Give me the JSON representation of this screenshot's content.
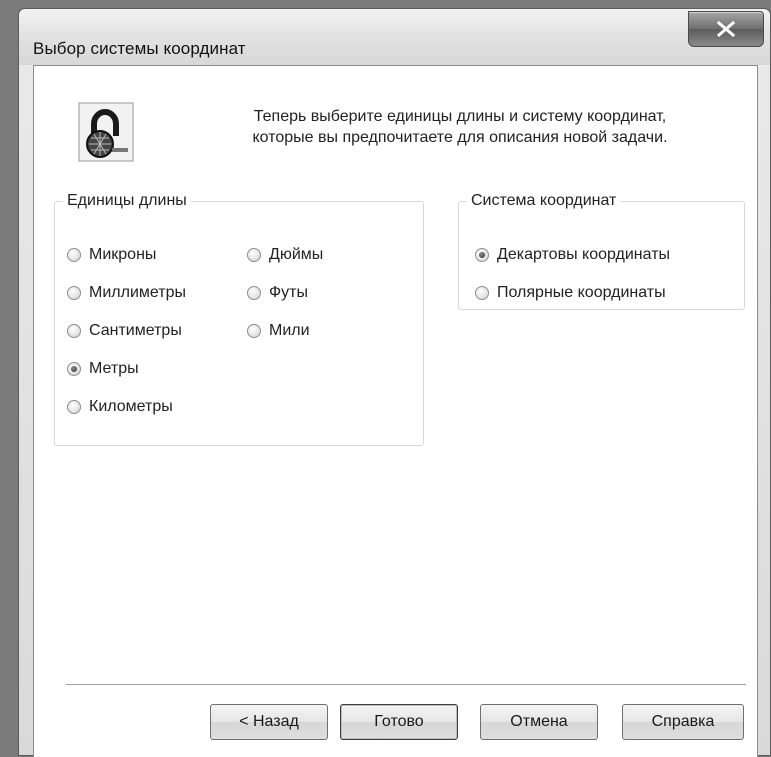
{
  "window": {
    "title": "Выбор системы координат"
  },
  "intro": {
    "line1": "Теперь выберите единицы длины и систему координат,",
    "line2": "которые вы предпочитаете для описания новой задачи."
  },
  "units_group": {
    "legend": "Единицы длины",
    "options": [
      {
        "label": "Микроны",
        "checked": false
      },
      {
        "label": "Миллиметры",
        "checked": false
      },
      {
        "label": "Сантиметры",
        "checked": false
      },
      {
        "label": "Метры",
        "checked": true
      },
      {
        "label": "Километры",
        "checked": false
      },
      {
        "label": "Дюймы",
        "checked": false
      },
      {
        "label": "Футы",
        "checked": false
      },
      {
        "label": "Мили",
        "checked": false
      }
    ]
  },
  "coords_group": {
    "legend": "Система координат",
    "options": [
      {
        "label": "Декартовы координаты",
        "checked": true
      },
      {
        "label": "Полярные координаты",
        "checked": false
      }
    ]
  },
  "buttons": {
    "back": "< Назад",
    "finish": "Готово",
    "cancel": "Отмена",
    "help": "Справка"
  },
  "icons": {
    "close": "close-icon",
    "wizard": "wizard-icon"
  }
}
